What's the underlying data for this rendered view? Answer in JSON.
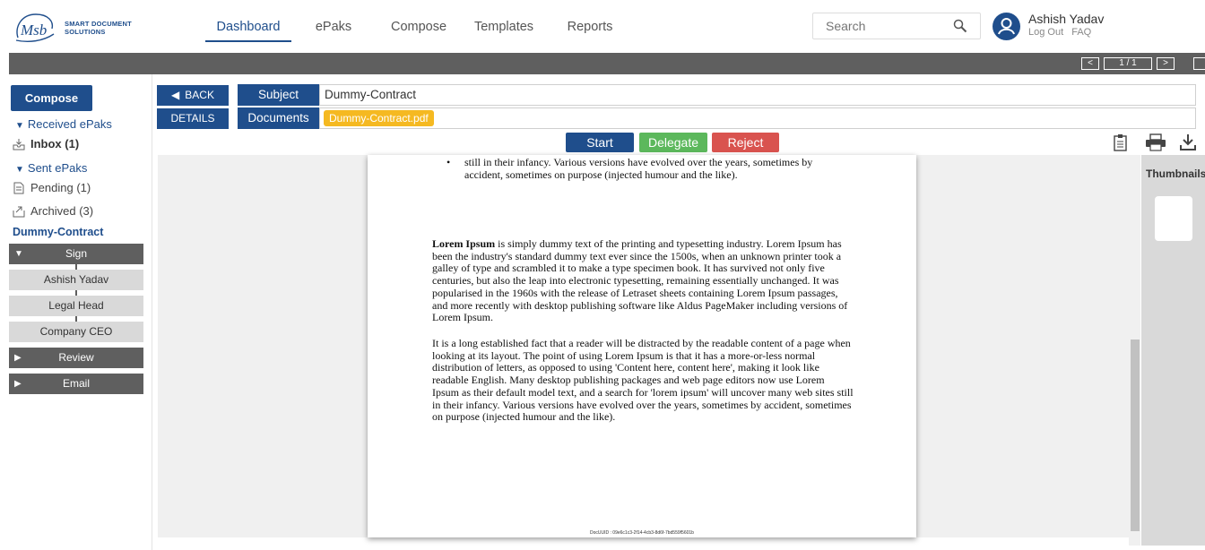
{
  "brand": {
    "logo_text": "Msb",
    "line1": "SMART DOCUMENT",
    "line2": "SOLUTIONS"
  },
  "nav": [
    {
      "label": "Dashboard",
      "active": true
    },
    {
      "label": "ePaks",
      "active": false
    },
    {
      "label": "Compose",
      "active": false
    },
    {
      "label": "Templates",
      "active": false
    },
    {
      "label": "Reports",
      "active": false
    }
  ],
  "search": {
    "placeholder": "Search",
    "icon": "search-icon"
  },
  "user": {
    "name": "Ashish Yadav",
    "logout": "Log Out",
    "faq": "FAQ"
  },
  "pager": {
    "prev": "<",
    "page": "1 / 1",
    "next": ">"
  },
  "sidebar": {
    "compose": "Compose",
    "received": "Received ePaks",
    "inbox": "Inbox (1)",
    "sent": "Sent ePaks",
    "pending": "Pending (1)",
    "archived": "Archived (3)",
    "document": "Dummy-Contract",
    "workflow": {
      "sign": "Sign",
      "signers": [
        "Ashish Yadav",
        "Legal Head",
        "Company CEO"
      ],
      "review": "Review",
      "email": "Email"
    }
  },
  "main": {
    "back": "BACK",
    "details": "DETAILS",
    "subject_label": "Subject",
    "subject_value": "Dummy-Contract",
    "documents_label": "Documents",
    "document_file": "Dummy-Contract.pdf",
    "actions": {
      "start": "Start",
      "delegate": "Delegate",
      "reject": "Reject"
    },
    "colors": {
      "primary": "#1f4e8c",
      "delegate": "#5cb85c",
      "reject": "#d9534f",
      "chip": "#f5b921"
    }
  },
  "document": {
    "bullet": "still in their infancy. Various versions have evolved over the years, sometimes by accident, sometimes on purpose (injected humour and the like).",
    "p1_bold": "Lorem Ipsum",
    "p1": " is simply dummy text of the printing and typesetting industry. Lorem Ipsum has been the industry's standard dummy text ever since the 1500s, when an unknown printer took a galley of type and scrambled it to make a type specimen book. It has survived not only five centuries, but also the leap into electronic typesetting, remaining essentially unchanged. It was popularised in the 1960s with the release of Letraset sheets containing Lorem Ipsum passages, and more recently with desktop publishing software like Aldus PageMaker including versions of Lorem Ipsum.",
    "p2": "It is a long established fact that a reader will be distracted by the readable content of a page when looking at its layout. The point of using Lorem Ipsum is that it has a more-or-less normal distribution of letters, as opposed to using 'Content here, content here', making it look like readable English. Many desktop publishing packages and web page editors now use Lorem Ipsum as their default model text, and a search for 'lorem ipsum' will uncover many web sites still in their infancy. Various versions have evolved over the years, sometimes by accident, sometimes on purpose (injected humour and the like).",
    "uid": "DocUUID : 09e6c1c3-2f14-4cb3-8d6f-7bd559f5601b"
  },
  "thumbnails": {
    "title": "Thumbnails"
  }
}
